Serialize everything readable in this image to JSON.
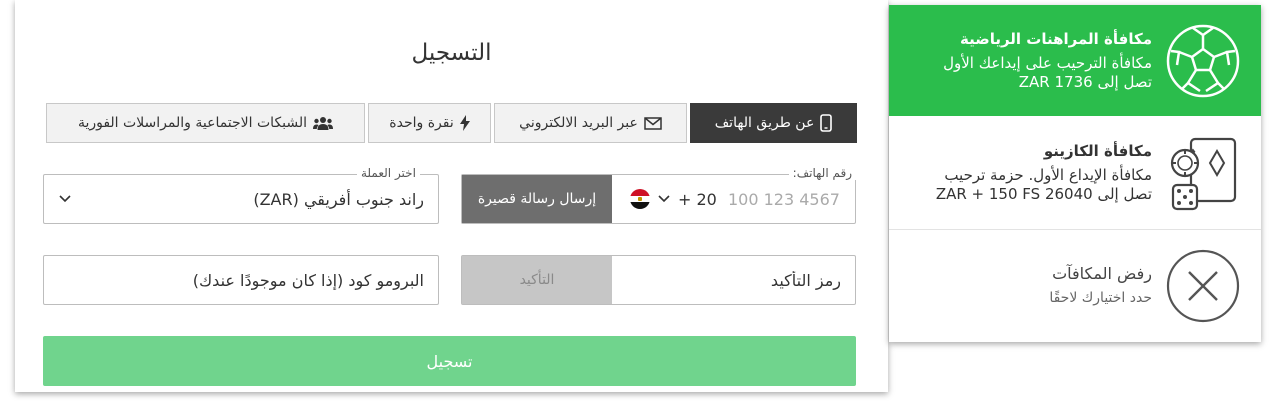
{
  "registration": {
    "title": "التسجيل",
    "tabs": [
      {
        "label": "عن طريق الهاتف",
        "icon": "phone-icon",
        "active": true
      },
      {
        "label": "عبر البريد الالكتروني",
        "icon": "envelope-icon",
        "active": false
      },
      {
        "label": "نقرة واحدة",
        "icon": "lightning-icon",
        "active": false
      },
      {
        "label": "الشبكات الاجتماعية والمراسلات الفورية",
        "icon": "users-icon",
        "active": false
      }
    ],
    "phone": {
      "label": "رقم الهاتف:",
      "country_code": "+ 20",
      "flag": "egypt-flag",
      "placeholder": "100 123 4567",
      "send_sms_label": "إرسال رسالة قصيرة"
    },
    "currency": {
      "label": "اختر العملة",
      "value": "راند جنوب أفريقي (ZAR)"
    },
    "confirmation": {
      "placeholder": "رمز التأكيد",
      "confirm_label": "التأكيد"
    },
    "promo": {
      "placeholder": "البرومو كود (إذا كان موجودًا عندك)"
    },
    "register_label": "تسجيل",
    "colors": {
      "active_tab": "#3a3a3a",
      "register_button": "#70d48d",
      "sms_button": "#6e6e6e"
    }
  },
  "bonuses": {
    "sports": {
      "title": "مكافأة المراهنات الرياضية",
      "desc_line1": "مكافأة الترحيب على إيداعك الأول",
      "desc_line2": "تصل إلى 1736 ZAR",
      "icon": "soccer-ball-icon",
      "selected": true,
      "color": "#2bbd4c"
    },
    "casino": {
      "title": "مكافأة الكازينو",
      "desc_line1": "مكافأة الإيداع الأول. حزمة ترحيب",
      "desc_line2": "تصل إلى 26040 ZAR + 150 FS",
      "icon": "casino-cards-icon",
      "selected": false
    },
    "decline": {
      "title": "رفض المكافآت",
      "desc": "حدد اختيارك لاحقًا",
      "icon": "close-circle-icon",
      "selected": false
    }
  }
}
